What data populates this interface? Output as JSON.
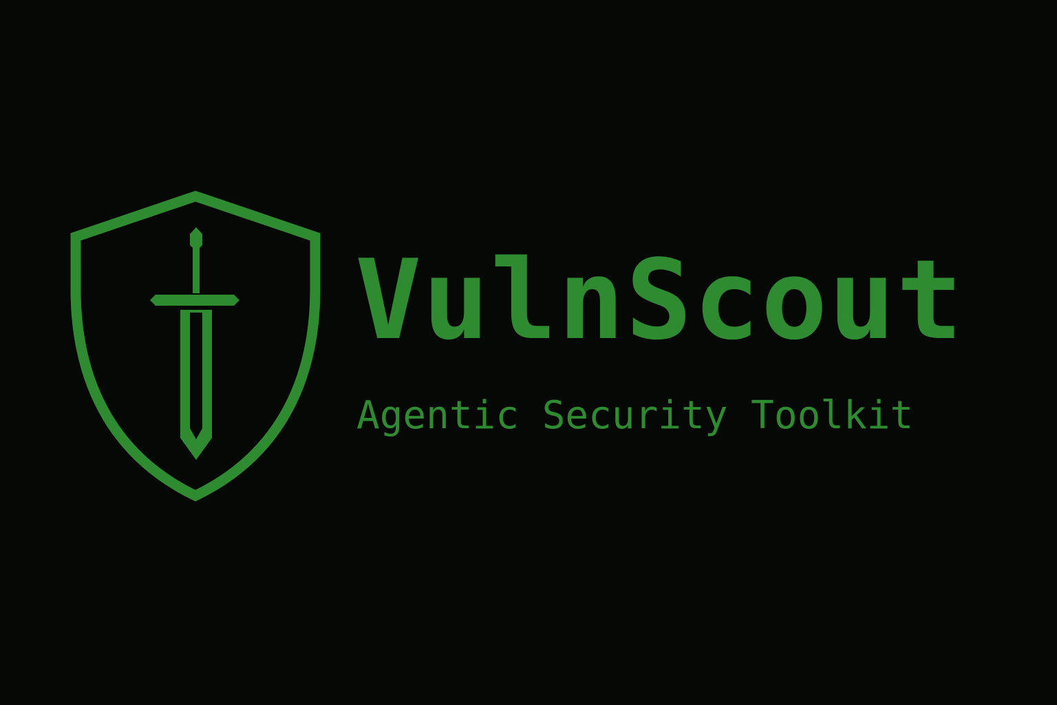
{
  "brand": {
    "name": "VulnScout",
    "tagline": "Agentic Security Toolkit",
    "accent_color": "#2e8b30",
    "background_color": "#060806"
  },
  "logo": {
    "icon": "shield-sword-icon"
  }
}
